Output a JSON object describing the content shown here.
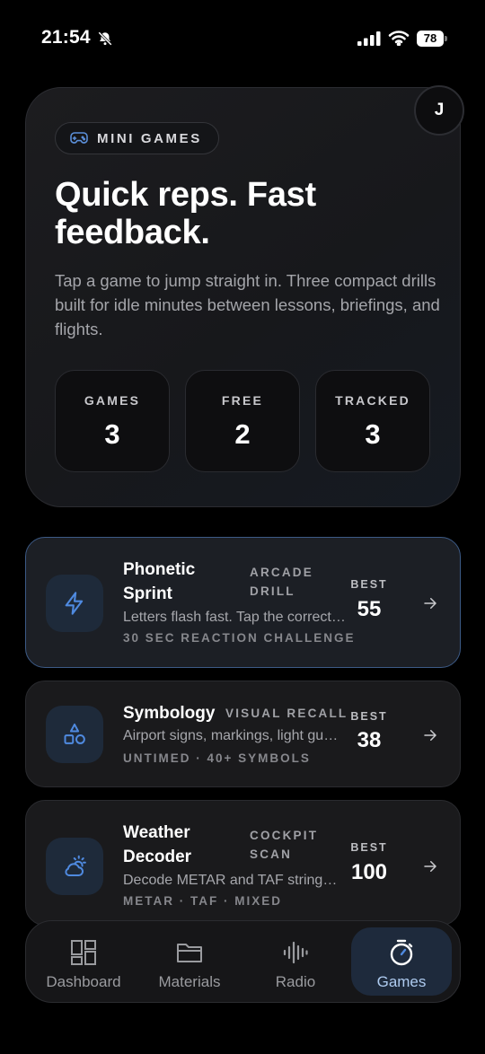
{
  "status_bar": {
    "time": "21:54",
    "battery": "78"
  },
  "header": {
    "avatar_initial": "J"
  },
  "hero": {
    "pill_label": "MINI GAMES",
    "headline": "Quick reps. Fast feedback.",
    "description": "Tap a game to jump straight in. Three compact drills built for idle minutes between lessons, briefings, and flights.",
    "stats": [
      {
        "label": "GAMES",
        "value": "3"
      },
      {
        "label": "FREE",
        "value": "2"
      },
      {
        "label": "TRACKED",
        "value": "3"
      }
    ]
  },
  "games": [
    {
      "title": "Phonetic Sprint",
      "tag": "ARCADE DRILL",
      "description": "Letters flash fast. Tap the correct call sign.",
      "meta": "30 SEC REACTION CHALLENGE",
      "best_label": "BEST",
      "best_value": "55",
      "icon": "lightning-icon"
    },
    {
      "title": "Symbology",
      "tag": "VISUAL RECALL",
      "description": "Airport signs, markings, light guns and more.",
      "meta": "UNTIMED · 40+ SYMBOLS",
      "best_label": "BEST",
      "best_value": "38",
      "icon": "shapes-icon"
    },
    {
      "title": "Weather Decoder",
      "tag": "COCKPIT SCAN",
      "description": "Decode METAR and TAF strings at speed.",
      "meta": "METAR · TAF · MIXED",
      "best_label": "BEST",
      "best_value": "100",
      "icon": "weather-icon"
    }
  ],
  "nav": {
    "items": [
      {
        "label": "Dashboard",
        "icon": "dashboard-icon"
      },
      {
        "label": "Materials",
        "icon": "folder-icon"
      },
      {
        "label": "Radio",
        "icon": "waveform-icon"
      },
      {
        "label": "Games",
        "icon": "stopwatch-icon",
        "active": true
      }
    ]
  },
  "colors": {
    "accent": "#3d7fd9",
    "active_nav_bg": "#1e2a3c",
    "active_card_border": "#3c5a86"
  }
}
